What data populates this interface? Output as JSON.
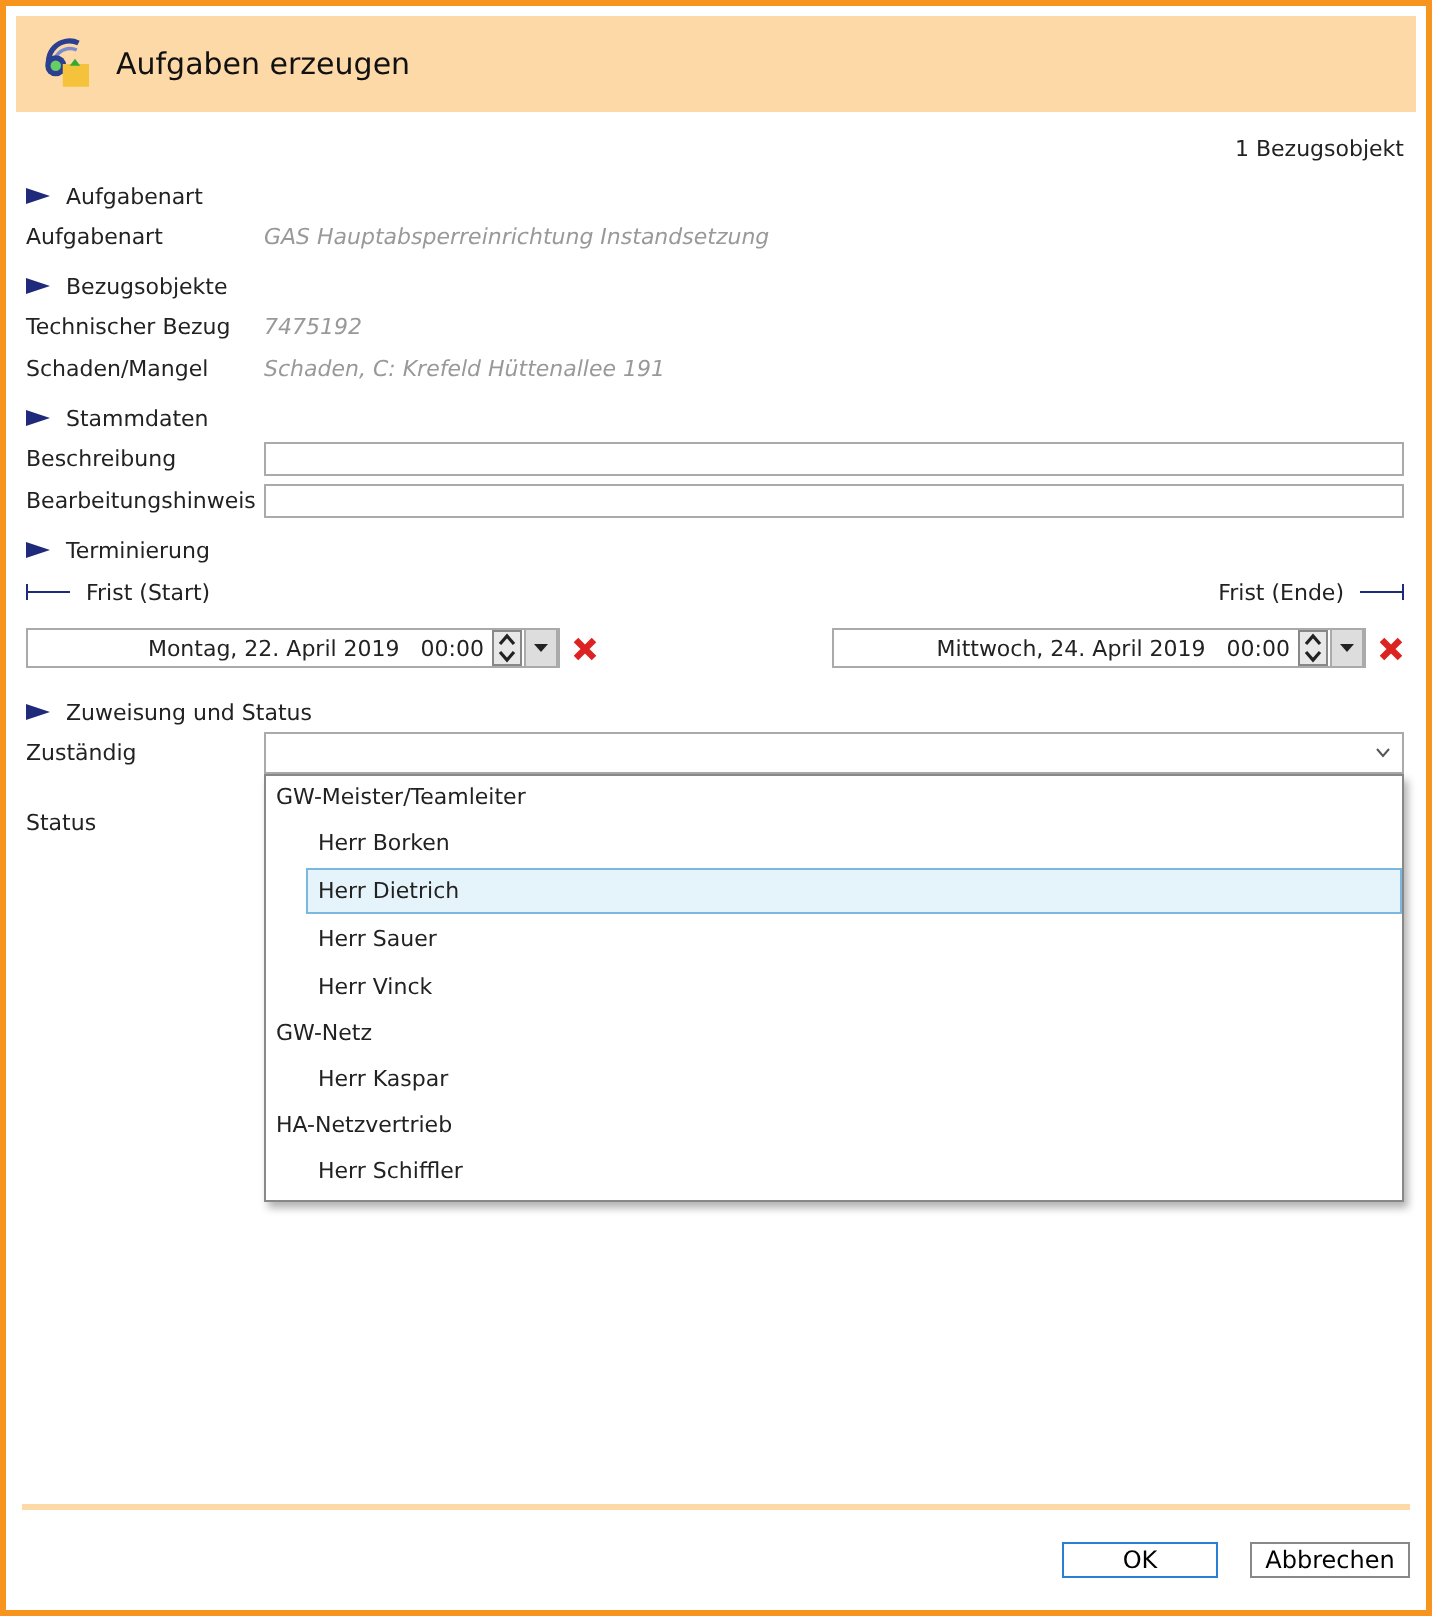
{
  "window": {
    "title": "Aufgaben erzeugen"
  },
  "reference_count": "1 Bezugsobjekt",
  "sections": [
    {
      "title": "Aufgabenart",
      "kind": "fields",
      "fields": [
        {
          "label": "Aufgabenart",
          "kind": "readonly",
          "value": "GAS Hauptabsperreinrichtung Instandsetzung"
        }
      ]
    },
    {
      "title": "Bezugsobjekte",
      "kind": "fields",
      "fields": [
        {
          "label": "Technischer Bezug",
          "kind": "readonly",
          "value": "7475192"
        },
        {
          "label": "Schaden/Mangel",
          "kind": "readonly",
          "value": "Schaden, C: Krefeld Hüttenallee 191"
        }
      ]
    },
    {
      "title": "Stammdaten",
      "kind": "fields",
      "fields": [
        {
          "label": "Beschreibung",
          "kind": "input"
        },
        {
          "label": "Bearbeitungshinweis",
          "kind": "input"
        }
      ]
    },
    {
      "title": "Terminierung",
      "kind": "dates",
      "start": {
        "label": "Frist (Start)",
        "date": "Montag, 22. April 2019",
        "time": "00:00"
      },
      "end": {
        "label": "Frist (Ende)",
        "date": "Mittwoch, 24. April 2019",
        "time": "00:00"
      }
    },
    {
      "title": "Zuweisung und Status",
      "kind": "fields",
      "fields": [
        {
          "label": "Zuständig",
          "kind": "combo",
          "expanded": true,
          "options": [
            {
              "label": "GW-Meister/Teamleiter",
              "children": [
                {
                  "label": "Herr Borken",
                  "selected": false
                },
                {
                  "label": "Herr Dietrich",
                  "selected": true
                },
                {
                  "label": "Herr Sauer",
                  "selected": false
                },
                {
                  "label": "Herr Vinck",
                  "selected": false
                }
              ]
            },
            {
              "label": "GW-Netz",
              "children": [
                {
                  "label": "Herr Kaspar",
                  "selected": false
                }
              ]
            },
            {
              "label": "HA-Netzvertrieb",
              "children": [
                {
                  "label": "Herr Schiffler",
                  "selected": false
                }
              ]
            }
          ]
        },
        {
          "label": "Status",
          "kind": "hidden"
        }
      ]
    }
  ],
  "buttons": [
    {
      "label": "OK",
      "default": true
    },
    {
      "label": "Abbrechen",
      "default": false
    }
  ]
}
